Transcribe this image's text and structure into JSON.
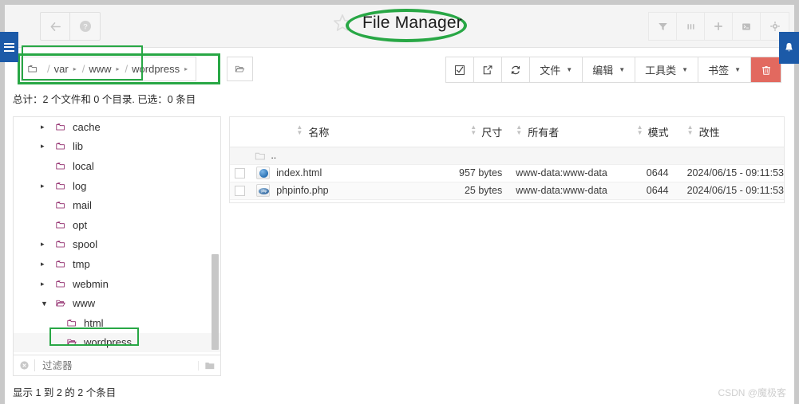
{
  "window": {
    "title": "File Manager",
    "star_icon": "star-outline-icon",
    "nav_back_icon": "arrow-left-icon",
    "nav_help_icon": "question-circle-icon",
    "left_tab_icon": "hamburger-menu-icon",
    "right_tab_icon": "bell-icon",
    "header_tools": [
      {
        "name": "filter-icon",
        "glyph": "▼"
      },
      {
        "name": "columns-icon",
        "glyph": "|||"
      },
      {
        "name": "plus-icon",
        "glyph": "＋"
      },
      {
        "name": "terminal-icon",
        "glyph": "▣"
      },
      {
        "name": "gear-icon",
        "glyph": "⚙"
      }
    ],
    "highlight_color": "#28a745"
  },
  "breadcrumb": {
    "folder_icon": "folder-icon",
    "segments": [
      "var",
      "www",
      "wordpress"
    ],
    "separator": "/",
    "caret": "▸",
    "open_folder_button_icon": "open-folder-icon"
  },
  "toolbar": {
    "buttons": [
      {
        "name": "select-all-button",
        "label": "",
        "icon": "checkbox-checked-icon",
        "glyph": "☑",
        "type": "icon"
      },
      {
        "name": "share-button",
        "label": "",
        "icon": "share-external-icon",
        "glyph": "↗",
        "type": "icon"
      },
      {
        "name": "refresh-button",
        "label": "",
        "icon": "refresh-icon",
        "glyph": "↻",
        "type": "icon"
      },
      {
        "name": "file-menu",
        "label": "文件",
        "type": "dropdown"
      },
      {
        "name": "edit-menu",
        "label": "编辑",
        "type": "dropdown"
      },
      {
        "name": "tools-menu",
        "label": "工具类",
        "type": "dropdown"
      },
      {
        "name": "bookmarks-menu",
        "label": "书签",
        "type": "dropdown"
      },
      {
        "name": "delete-button",
        "label": "",
        "icon": "trash-icon",
        "glyph": "🗑",
        "type": "danger"
      }
    ],
    "delete_color": "#e2695f"
  },
  "summary": "总计：2 个文件和 0 个目录. 已选：0 条目",
  "tree": {
    "nodes": [
      {
        "label": "cache",
        "depth": 1,
        "expandable": true,
        "expanded": false,
        "selected": false
      },
      {
        "label": "lib",
        "depth": 1,
        "expandable": true,
        "expanded": false,
        "selected": false
      },
      {
        "label": "local",
        "depth": 1,
        "expandable": false,
        "expanded": false,
        "selected": false
      },
      {
        "label": "log",
        "depth": 1,
        "expandable": true,
        "expanded": false,
        "selected": false
      },
      {
        "label": "mail",
        "depth": 1,
        "expandable": false,
        "expanded": false,
        "selected": false
      },
      {
        "label": "opt",
        "depth": 1,
        "expandable": false,
        "expanded": false,
        "selected": false
      },
      {
        "label": "spool",
        "depth": 1,
        "expandable": true,
        "expanded": false,
        "selected": false
      },
      {
        "label": "tmp",
        "depth": 1,
        "expandable": true,
        "expanded": false,
        "selected": false
      },
      {
        "label": "webmin",
        "depth": 1,
        "expandable": true,
        "expanded": false,
        "selected": false
      },
      {
        "label": "www",
        "depth": 1,
        "expandable": true,
        "expanded": true,
        "selected": false
      },
      {
        "label": "html",
        "depth": 2,
        "expandable": false,
        "expanded": false,
        "selected": false
      },
      {
        "label": "wordpress",
        "depth": 2,
        "expandable": false,
        "expanded": true,
        "selected": true
      }
    ],
    "filter_placeholder": "过滤器",
    "filter_value": "",
    "filter_clear_icon": "clear-circle-icon",
    "filter_folder_icon": "folder-icon"
  },
  "table": {
    "columns": [
      {
        "key": "name",
        "label": "名称",
        "sortable": true
      },
      {
        "key": "size",
        "label": "尺寸",
        "sortable": true
      },
      {
        "key": "owner",
        "label": "所有者",
        "sortable": true
      },
      {
        "key": "mode",
        "label": "模式",
        "sortable": true
      },
      {
        "key": "mtime",
        "label": "改性",
        "sortable": true
      }
    ],
    "parent_row": {
      "label": "..",
      "icon": "folder-icon"
    },
    "rows": [
      {
        "name": "index.html",
        "icon": "globe-icon",
        "icon_text": "",
        "size": "957 bytes",
        "owner": "www-data:www-data",
        "mode": "0644",
        "mtime": "2024/06/15 - 09:11:53",
        "checked": false
      },
      {
        "name": "phpinfo.php",
        "icon": "php-icon",
        "icon_text": "php",
        "size": "25 bytes",
        "owner": "www-data:www-data",
        "mode": "0644",
        "mtime": "2024/06/15 - 09:11:53",
        "checked": false
      }
    ]
  },
  "footer": {
    "status": "显示 1 到 2 的 2 个条目",
    "watermark": "CSDN @魔极客"
  }
}
